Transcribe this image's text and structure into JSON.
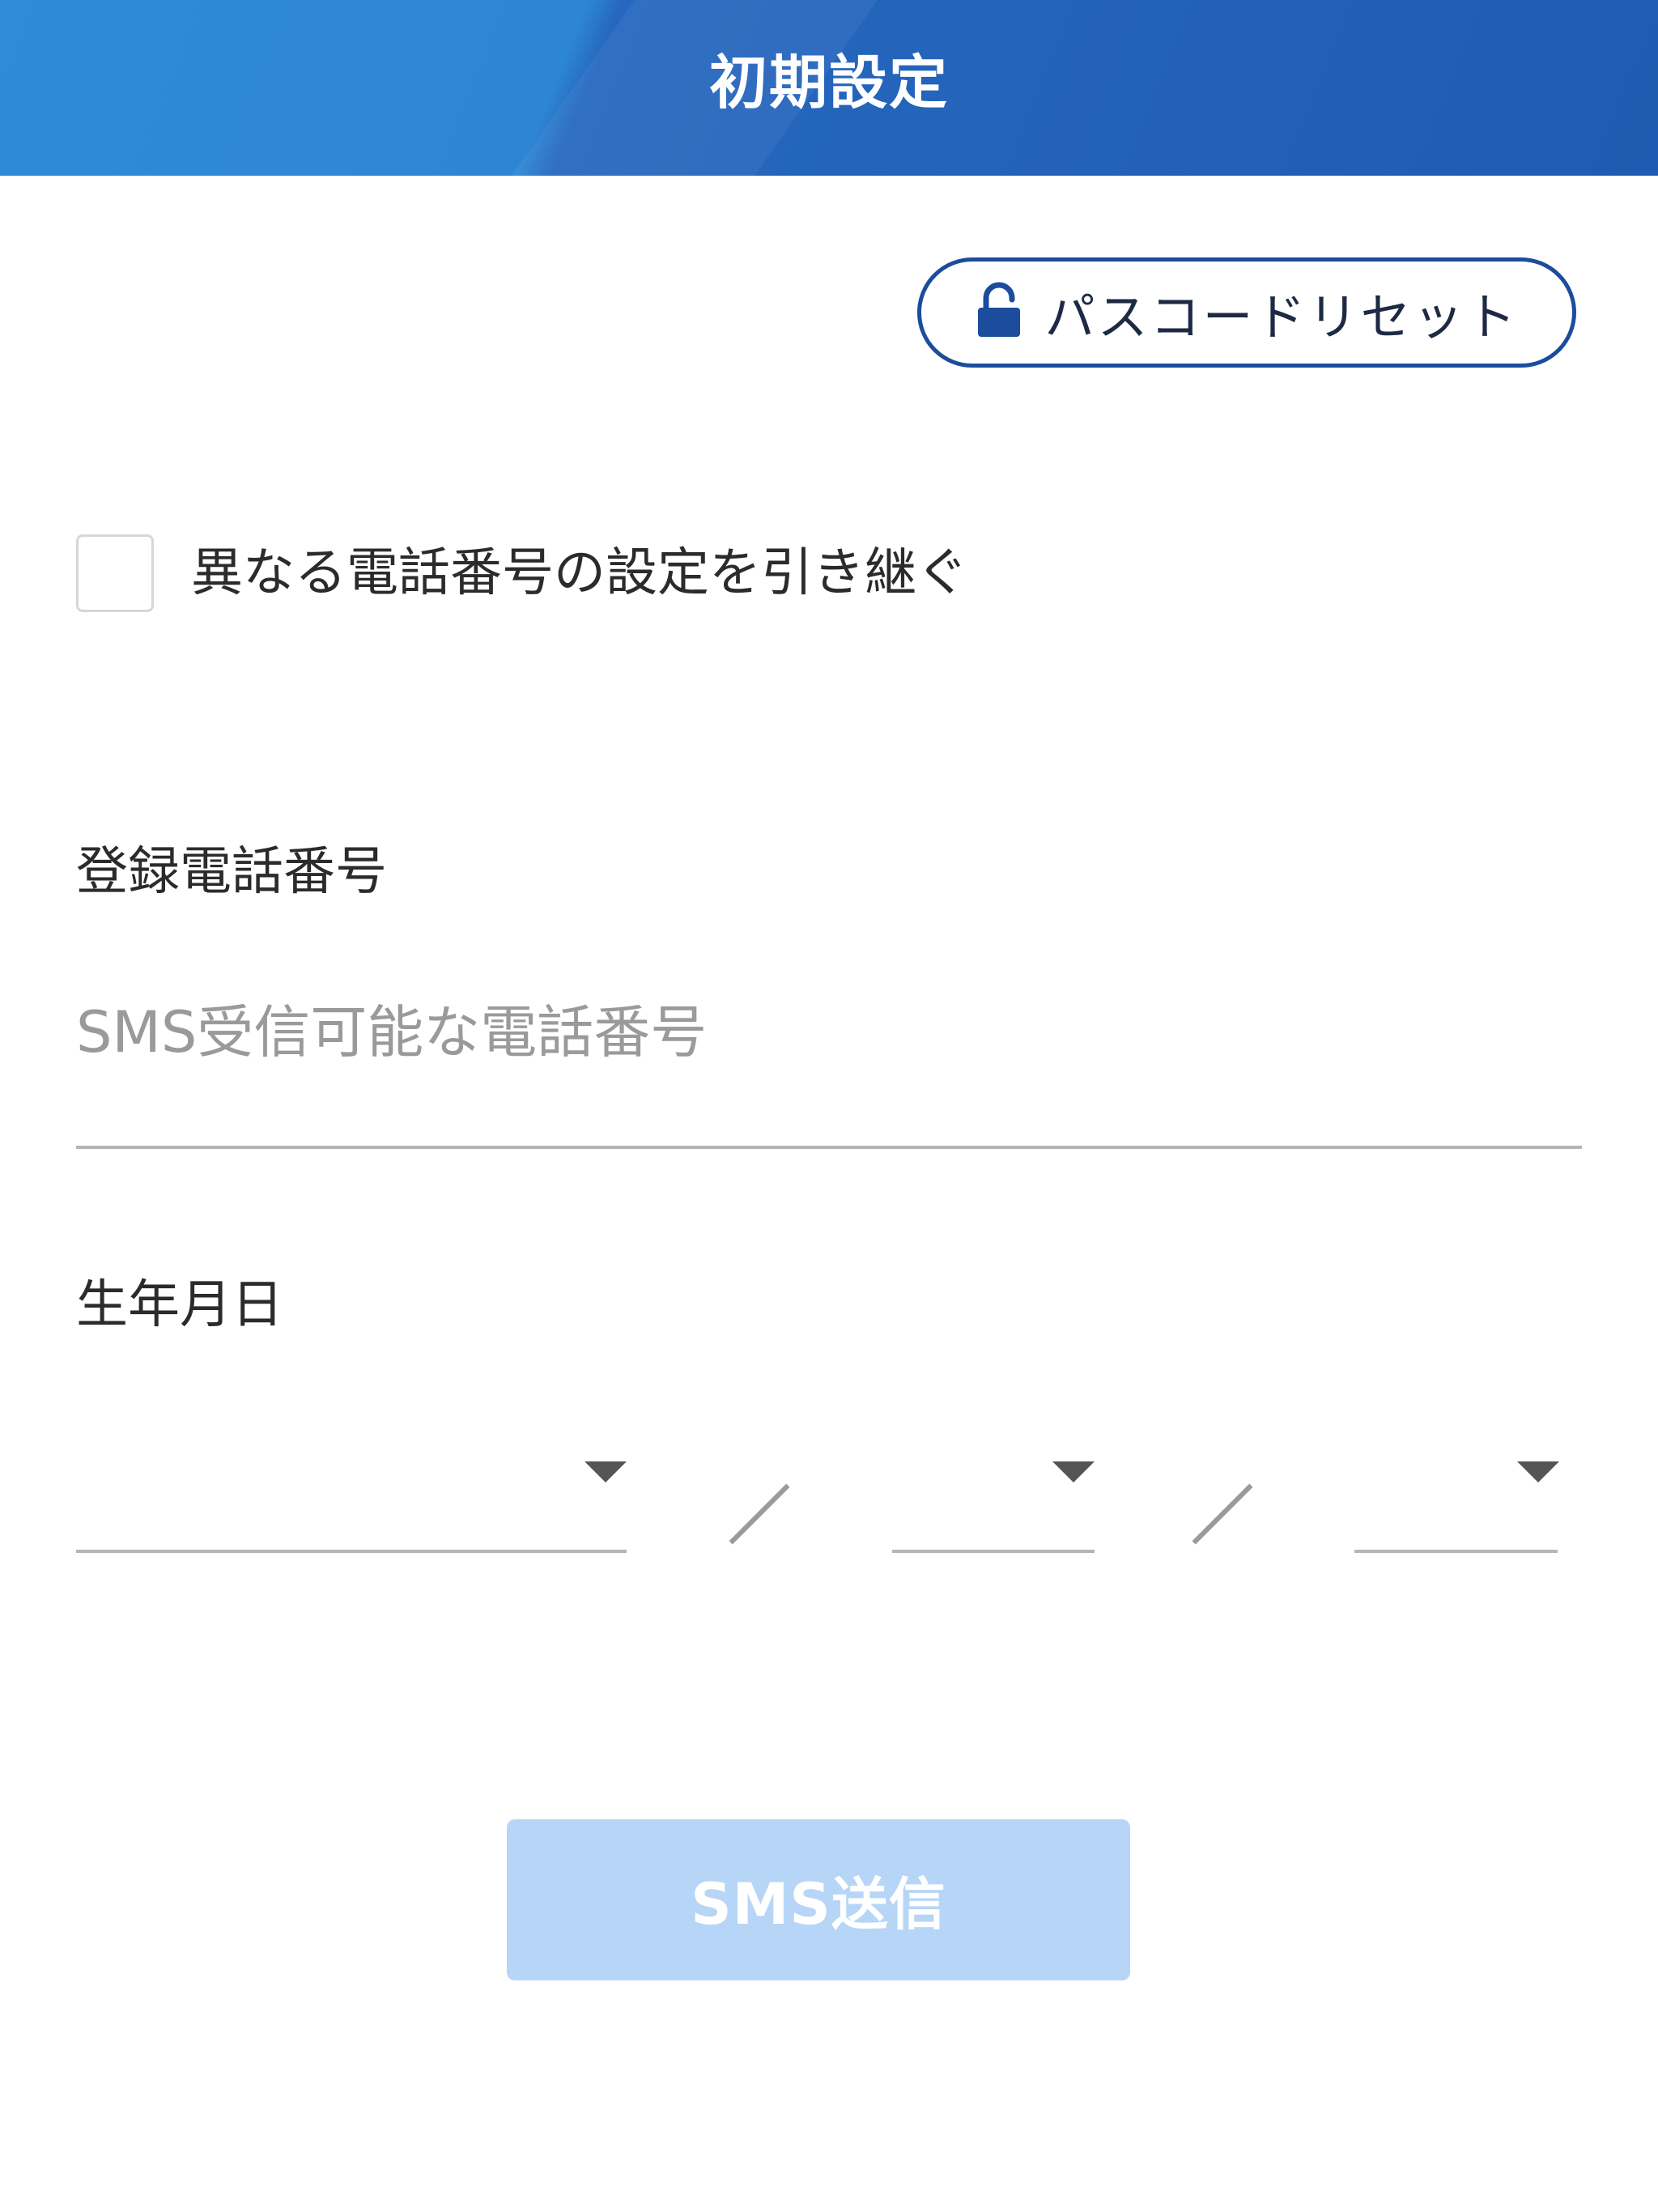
{
  "header": {
    "title": "初期設定"
  },
  "passcode_reset": {
    "label": "パスコードリセット",
    "icon": "unlock-icon"
  },
  "inherit_setting": {
    "label": "異なる電話番号の設定を引き継ぐ",
    "checked": false
  },
  "phone": {
    "label": "登録電話番号",
    "placeholder": "SMS受信可能な電話番号",
    "value": ""
  },
  "birthday": {
    "label": "生年月日",
    "year": "",
    "month": "",
    "day": ""
  },
  "sms_button": {
    "label": "SMS送信",
    "enabled": false
  },
  "colors": {
    "header_blue": "#2668bf",
    "accent_navy": "#1b4d9c",
    "disabled_button": "#b7d6f7"
  }
}
